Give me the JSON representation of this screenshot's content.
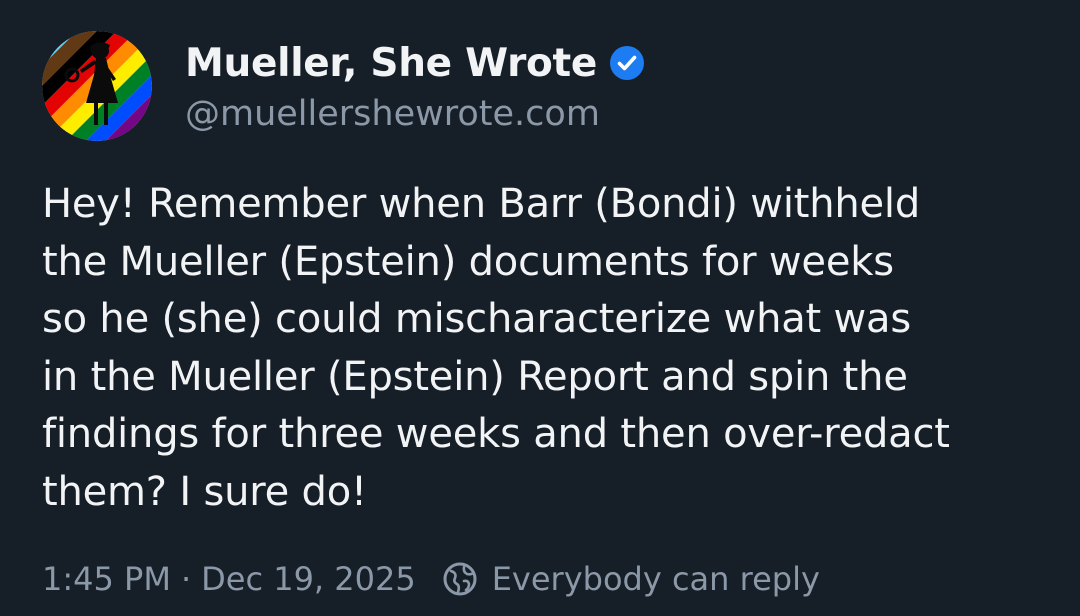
{
  "author": {
    "display_name": "Mueller, She Wrote",
    "handle": "@muellershewrote.com",
    "verified": true
  },
  "post": {
    "text": "Hey! Remember when Barr (Bondi) withheld\nthe Mueller (Epstein) documents for weeks\nso he (she) could mischaracterize what was\nin the Mueller (Epstein) Report and spin the\nfindings for three weeks and then over-redact\nthem? I sure do!"
  },
  "meta": {
    "time": "1:45 PM",
    "separator": "·",
    "date": "Dec 19, 2025",
    "reply_setting": "Everybody can reply",
    "reply_icon": "globe-icon"
  },
  "colors": {
    "background": "#161e27",
    "text_primary": "#f1f3f5",
    "text_secondary": "#8b98a8",
    "verified_badge": "#1d7cf2"
  },
  "avatar": {
    "icon": "rainbow-stripes-silhouette-avatar"
  }
}
